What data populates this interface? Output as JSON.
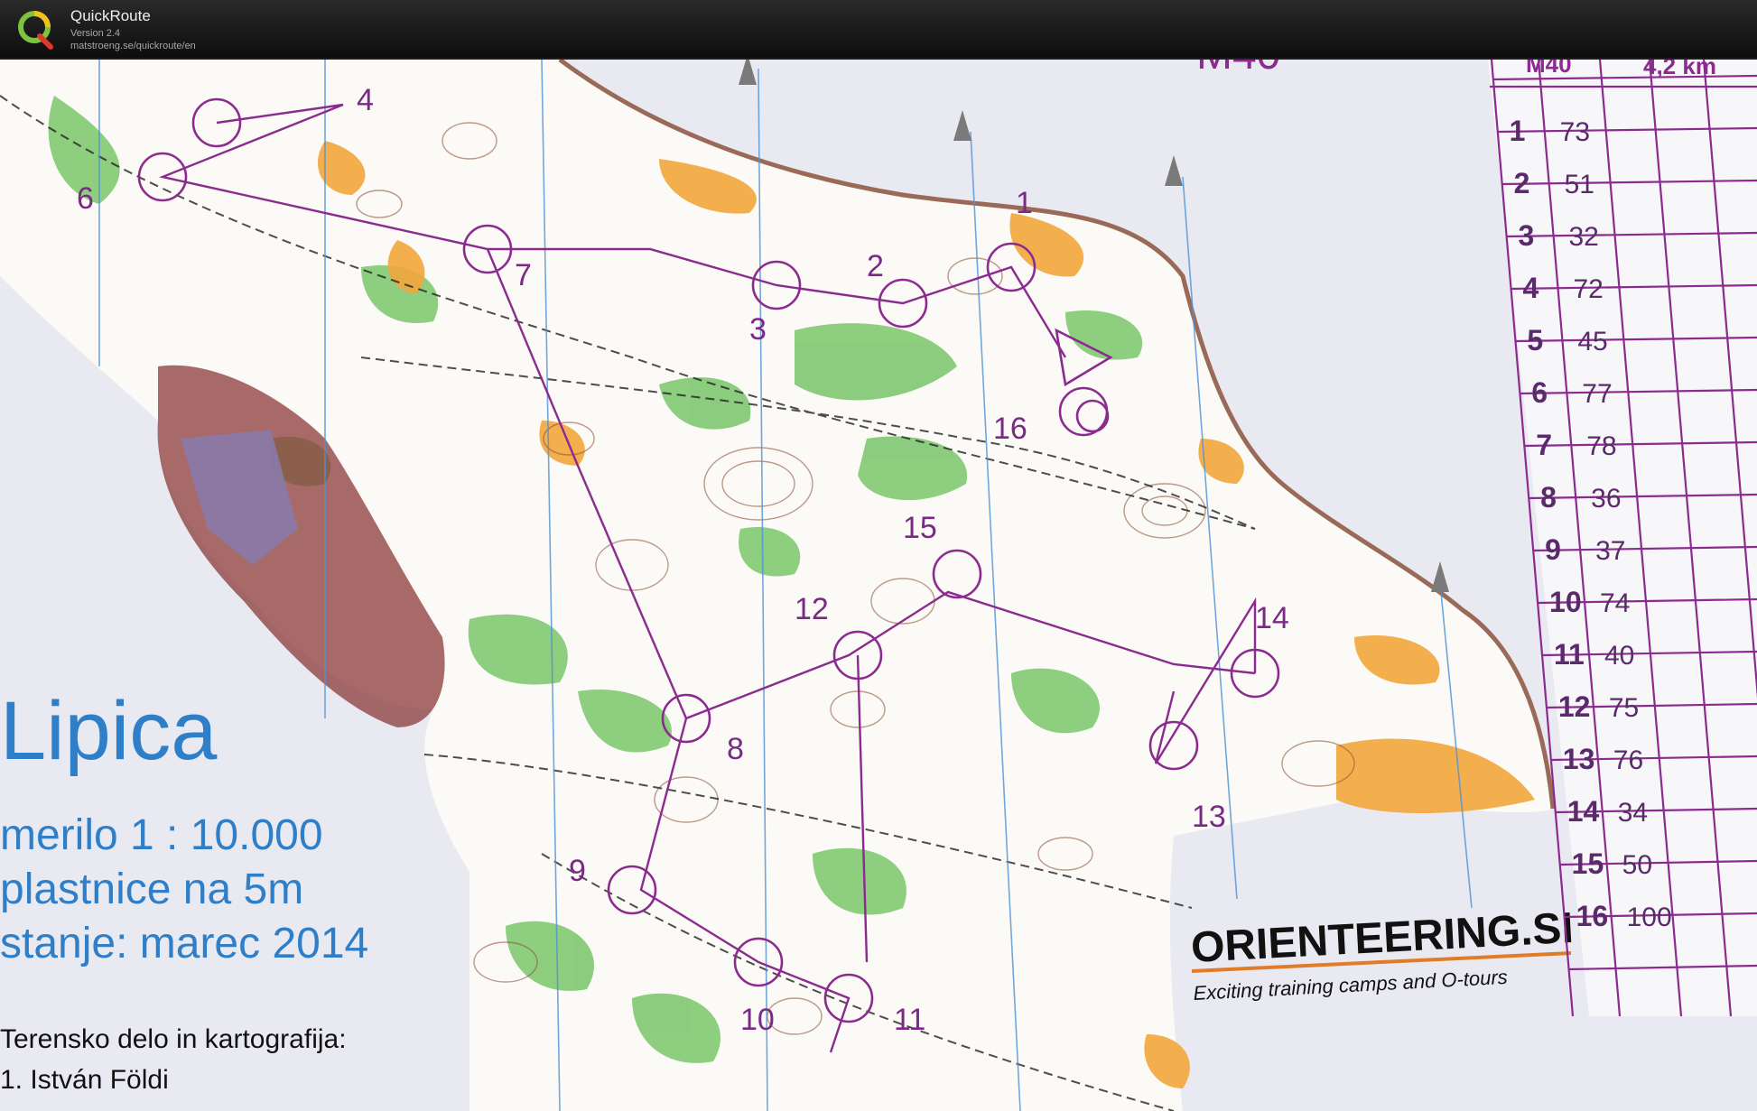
{
  "app": {
    "title": "QuickRoute",
    "version": "Version 2.4",
    "url": "matstroeng.se/quickroute/en"
  },
  "map": {
    "name": "Lipica",
    "scale": "merilo 1 : 10.000",
    "contours": "plastnice na 5m",
    "status": "stanje: marec 2014",
    "credits_heading": "Terensko delo in kartografija:",
    "credits_line1": "1. István Földi",
    "sponsor_name": "ORIENTEERING.SI",
    "sponsor_tagline": "Exciting training camps and O-tours",
    "course_label": "M40",
    "course_length": "4,2 km",
    "colors": {
      "course": "#8b2a8f",
      "text_blue": "#2f7fc8",
      "vegetation_green": "#6bbf59",
      "open_yellow": "#f0a63a",
      "contour_brown": "#8a4a32"
    }
  },
  "course_controls": [
    {
      "label": "1"
    },
    {
      "label": "2"
    },
    {
      "label": "3"
    },
    {
      "label": "4"
    },
    {
      "label": "6"
    },
    {
      "label": "7"
    },
    {
      "label": "8"
    },
    {
      "label": "9"
    },
    {
      "label": "10"
    },
    {
      "label": "11"
    },
    {
      "label": "12"
    },
    {
      "label": "13"
    },
    {
      "label": "14"
    },
    {
      "label": "15"
    },
    {
      "label": "16"
    }
  ],
  "control_descriptions": [
    {
      "num": "1",
      "code": "73"
    },
    {
      "num": "2",
      "code": "51"
    },
    {
      "num": "3",
      "code": "32"
    },
    {
      "num": "4",
      "code": "72"
    },
    {
      "num": "5",
      "code": "45"
    },
    {
      "num": "6",
      "code": "77"
    },
    {
      "num": "7",
      "code": "78"
    },
    {
      "num": "8",
      "code": "36"
    },
    {
      "num": "9",
      "code": "37"
    },
    {
      "num": "10",
      "code": "74"
    },
    {
      "num": "11",
      "code": "40"
    },
    {
      "num": "12",
      "code": "75"
    },
    {
      "num": "13",
      "code": "76"
    },
    {
      "num": "14",
      "code": "34"
    },
    {
      "num": "15",
      "code": "50"
    },
    {
      "num": "16",
      "code": "100"
    }
  ]
}
